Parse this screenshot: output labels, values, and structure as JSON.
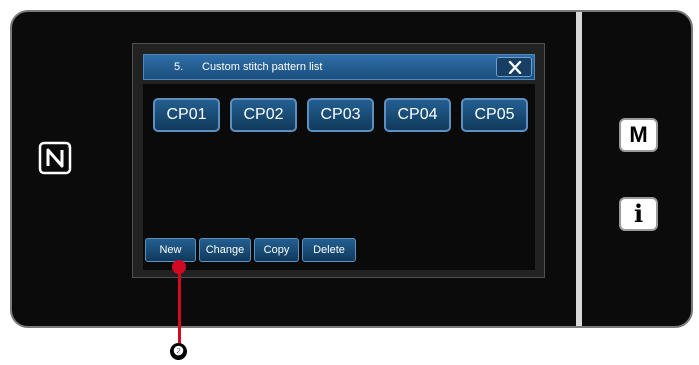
{
  "dialog": {
    "number": "5.",
    "title": "Custom stitch pattern list",
    "close_icon": "close-icon"
  },
  "patterns": [
    "CP01",
    "CP02",
    "CP03",
    "CP04",
    "CP05"
  ],
  "actions": {
    "new_label": "New",
    "change_label": "Change",
    "copy_label": "Copy",
    "delete_label": "Delete"
  },
  "side_buttons": {
    "mode_label": "M",
    "info_label": "i"
  },
  "icons": {
    "nfc": "nfc-icon",
    "close": "close-icon"
  },
  "callout": {
    "label": "❷"
  },
  "colors": {
    "button_blue": "#1a4e7c",
    "button_border": "#5e8fbe",
    "device_body": "#0b0b0b",
    "callout_red": "#d10a22"
  }
}
